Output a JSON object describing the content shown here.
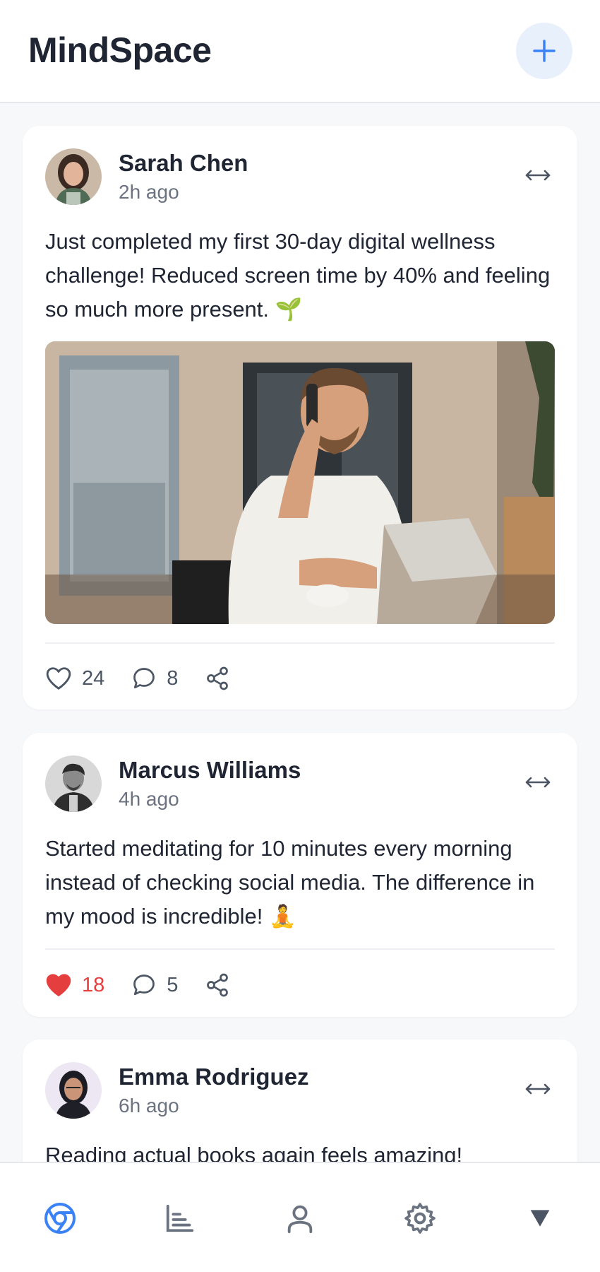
{
  "app": {
    "title": "MindSpace",
    "accent": "#3b82f6",
    "like_color": "#e53e3e"
  },
  "header": {
    "add_icon": "plus-icon"
  },
  "posts": [
    {
      "author": "Sarah Chen",
      "time": "2h ago",
      "text": "Just completed my first 30-day digital wellness challenge! Reduced screen time by 40% and feeling so much more present. 🌱",
      "has_image": true,
      "likes": "24",
      "comments": "8",
      "liked": false
    },
    {
      "author": "Marcus Williams",
      "time": "4h ago",
      "text": "Started meditating for 10 minutes every morning instead of checking social media. The difference in my mood is incredible! 🧘",
      "has_image": false,
      "likes": "18",
      "comments": "5",
      "liked": true
    },
    {
      "author": "Emma Rodriguez",
      "time": "6h ago",
      "text": "Reading actual books again feels amazing!",
      "has_image": false
    }
  ],
  "nav": {
    "items": [
      "home-icon",
      "stats-icon",
      "profile-icon",
      "settings-icon",
      "more-icon"
    ],
    "active": "home-icon"
  }
}
